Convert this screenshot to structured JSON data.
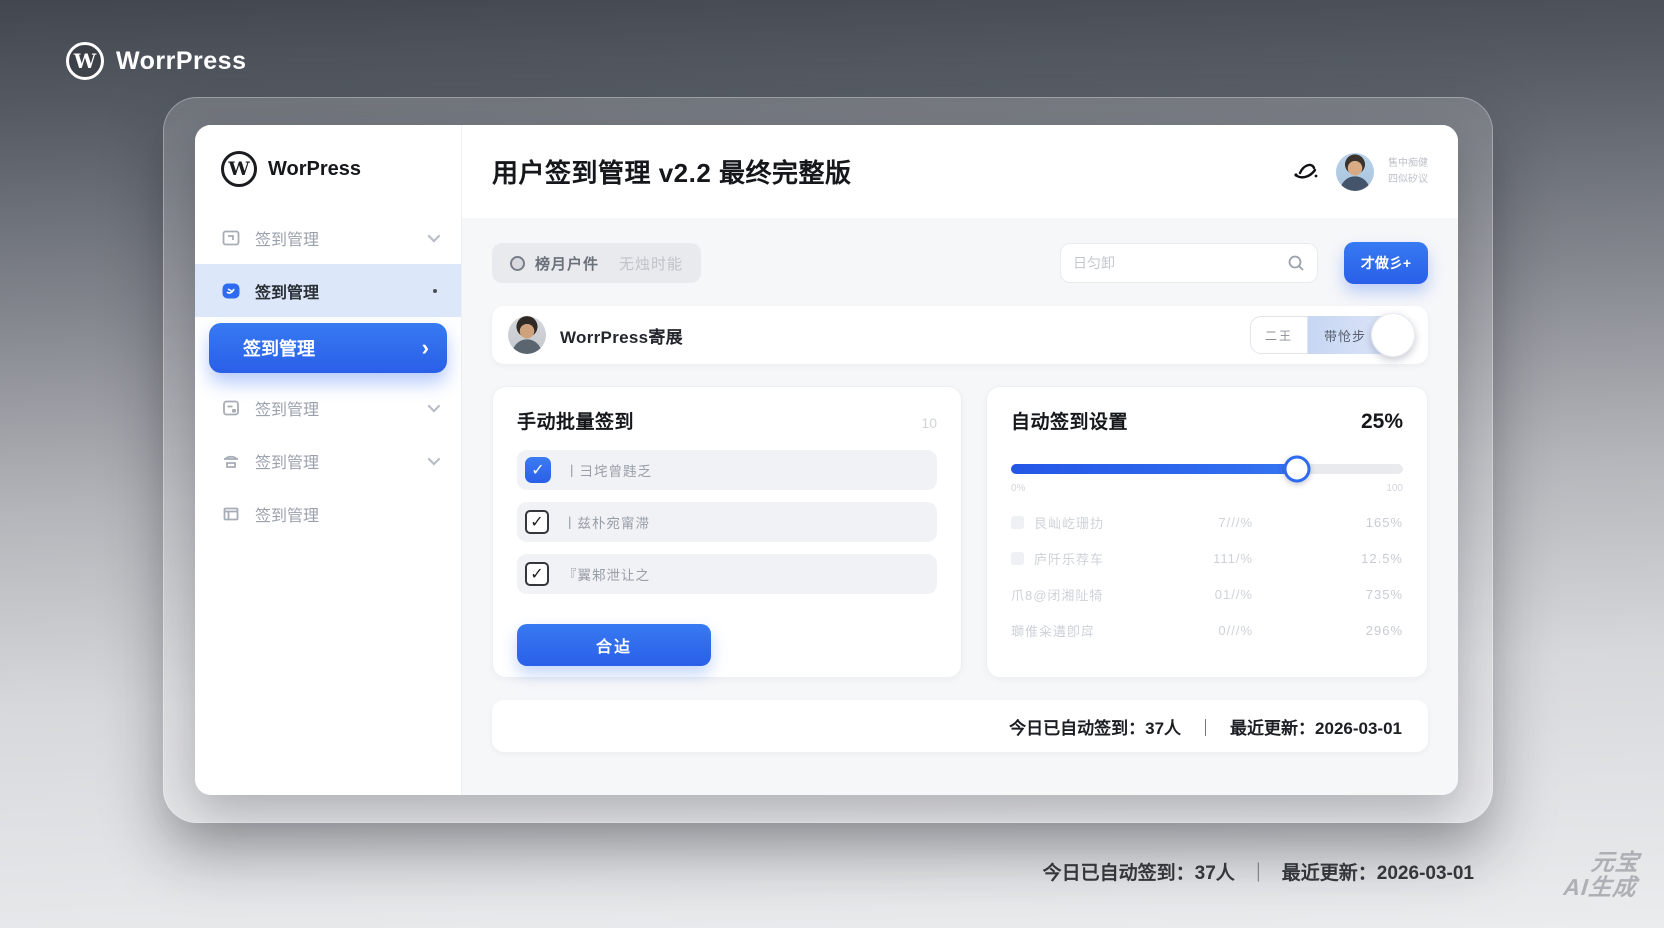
{
  "brand": {
    "logo_letter": "W",
    "name": "WorrPress"
  },
  "window": {
    "sidebar": {
      "logo_letter": "W",
      "logo_name": "WorPress",
      "items": [
        {
          "label": "签到管理"
        },
        {
          "label": "签到管理"
        },
        {
          "label": "签到管理",
          "chevron": "›"
        },
        {
          "label": "签到管理"
        },
        {
          "label": "签到管理"
        },
        {
          "label": "签到管理"
        }
      ]
    },
    "header": {
      "title": "用户签到管理 v2.2 最终完整版",
      "user_line1": "售中痴健",
      "user_line2": "四似矽议"
    },
    "toolbar": {
      "chip_label": "榜月户件",
      "chip_label2": "无烛时能",
      "search_placeholder": "日匀卸",
      "primary_button": "才做彡+"
    },
    "user_row": {
      "name": "WorrPress寄展",
      "toggle_left": "二王",
      "toggle_right": "带怆步"
    },
    "manual_card": {
      "title": "手动批量签到",
      "count": "10",
      "options": [
        {
          "label": "丨彐垞曾韪乏",
          "check": "✓"
        },
        {
          "label": "丨兹朴宛甯滞",
          "check": "✓"
        },
        {
          "label": "『翼邾泄让之",
          "check": "✓"
        }
      ],
      "submit_label": "合迠"
    },
    "auto_card": {
      "title": "自动签到设置",
      "percent": "25%",
      "slider": {
        "fill": "73%",
        "min_label": "0%",
        "max_label": "100"
      },
      "stats": [
        {
          "label": "艮屾屹珊扐",
          "mid": "7///%",
          "right": "165%"
        },
        {
          "label": "庐阡乐荐车",
          "mid": "111/%",
          "right": "12.5%"
        },
        {
          "label": "爪8@闭湘阯犄",
          "mid": "01//%",
          "right": "735%"
        },
        {
          "label": "瑡倠籴遘卽戽",
          "mid": "0///%",
          "right": "296%"
        }
      ]
    },
    "status_bar": {
      "summary": "今日已自动签到：37人",
      "divider": "｜",
      "updated": "最近更新：2026-03-01"
    }
  },
  "footer": {
    "summary": "今日已自动签到：37人",
    "divider": "｜",
    "updated": "最近更新：2026-03-01"
  },
  "watermark": {
    "line1": "元宝",
    "line2": "AI生成"
  },
  "colors": {
    "accent": "#2e6bf0",
    "active_row": "#dce8fa",
    "page_top": "#41464f",
    "page_bottom": "#ebecee"
  }
}
